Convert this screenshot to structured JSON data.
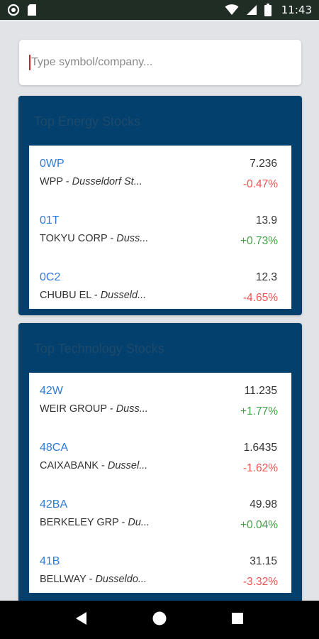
{
  "status_bar": {
    "time": "11:43",
    "icons": [
      "circle-notification-icon",
      "sd-card-icon",
      "wifi-icon",
      "signal-icon",
      "battery-icon"
    ]
  },
  "search": {
    "placeholder": "Type symbol/company..."
  },
  "sections": [
    {
      "title": "Top Energy Stocks",
      "stocks": [
        {
          "symbol": "0WP",
          "company": "WPP",
          "exchange": "Dusseldorf St...",
          "price": "7.236",
          "change": "-0.47%",
          "direction": "negative"
        },
        {
          "symbol": "01T",
          "company": "TOKYU CORP",
          "exchange": "Duss...",
          "price": "13.9",
          "change": "+0.73%",
          "direction": "positive"
        },
        {
          "symbol": "0C2",
          "company": "CHUBU EL",
          "exchange": "Dusseld...",
          "price": "12.3",
          "change": "-4.65%",
          "direction": "negative"
        }
      ]
    },
    {
      "title": "Top Technology Stocks",
      "stocks": [
        {
          "symbol": "42W",
          "company": "WEIR GROUP",
          "exchange": "Duss...",
          "price": "11.235",
          "change": "+1.77%",
          "direction": "positive"
        },
        {
          "symbol": "48CA",
          "company": "CAIXABANK",
          "exchange": "Dussel...",
          "price": "1.6435",
          "change": "-1.62%",
          "direction": "negative"
        },
        {
          "symbol": "42BA",
          "company": "BERKELEY GRP",
          "exchange": "Du...",
          "price": "49.98",
          "change": "+0.04%",
          "direction": "positive"
        },
        {
          "symbol": "41B",
          "company": "BELLWAY",
          "exchange": "Dusseldo...",
          "price": "31.15",
          "change": "-3.32%",
          "direction": "negative"
        }
      ]
    }
  ],
  "nav_bar": {
    "icons": [
      "back-icon",
      "home-icon",
      "recents-icon"
    ]
  },
  "colors": {
    "card_background": "#04406d",
    "symbol": "#2f7bd8",
    "negative": "#ef5350",
    "positive": "#43a047",
    "page_background": "#e1e3e6"
  }
}
